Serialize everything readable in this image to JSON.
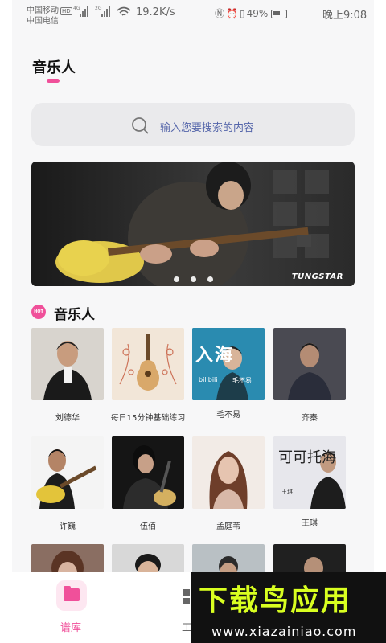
{
  "status_bar": {
    "carrier_1": "中国移动",
    "hd_badge": "HD",
    "carrier_2": "中国电信",
    "signal_1_label": "4G",
    "signal_2_label": "2G",
    "net_speed": "19.2K/s",
    "battery": "49%",
    "time": "晚上9:08",
    "icons": [
      "nfc-icon",
      "alarm-icon",
      "vibrate-icon",
      "battery-icon"
    ]
  },
  "header": {
    "title": "音乐人"
  },
  "search": {
    "placeholder": "输入您要搜索的内容"
  },
  "banner": {
    "brand": "TUNGSTAR",
    "dots": 3
  },
  "section": {
    "badge": "HOT",
    "title": "音乐人"
  },
  "musicians": [
    {
      "name": "刘德华"
    },
    {
      "name": "每日15分钟基础练习"
    },
    {
      "name": "毛不易",
      "overlay_title": "入海",
      "overlay_left": "bilibili",
      "overlay_right": "毛不易"
    },
    {
      "name": "齐秦"
    },
    {
      "name": "许巍"
    },
    {
      "name": "伍佰"
    },
    {
      "name": "孟庭苇"
    },
    {
      "name": "王琪",
      "overlay_title": "可可托海",
      "overlay_sub": "王琪"
    }
  ],
  "bottom_nav": {
    "tab_1": "谱库",
    "tab_2": "工"
  },
  "watermark": {
    "title": "下载鸟应用",
    "url": "www.xiazainiao.com"
  },
  "colors": {
    "accent": "#f0509a",
    "background": "#f7f7f8",
    "search_bg": "#eaeaec",
    "watermark_yellow": "#d9ff20"
  }
}
